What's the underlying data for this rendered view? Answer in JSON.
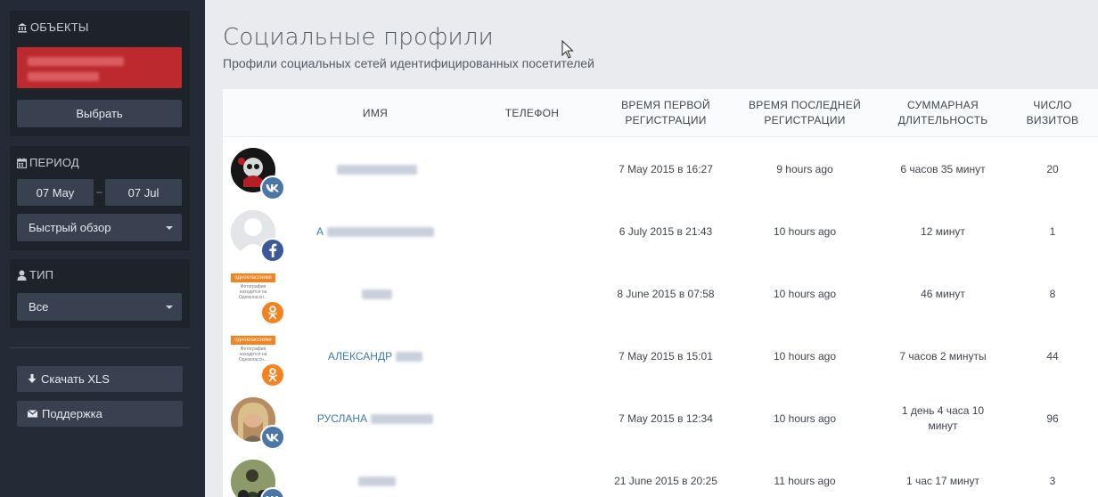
{
  "sidebar": {
    "objects": {
      "title": "ОБЪЕКТЫ",
      "select_label": "Выбрать"
    },
    "period": {
      "title": "ПЕРИОД",
      "date_from": "07 May",
      "date_to": "07 Jul",
      "dash": "–",
      "quick_view": "Быстрый обзор"
    },
    "type": {
      "title": "ТИП",
      "value": "Все"
    },
    "download_label": "Скачать XLS",
    "support_label": "Поддержка"
  },
  "main": {
    "title": "Социальные профили",
    "subtitle": "Профили социальных сетей идентифицированных посетителей",
    "columns": [
      "Имя",
      "Телефон",
      "Время первой регистрации",
      "Время последней регистрации",
      "Суммарная длительность",
      "Число визитов"
    ],
    "rows": [
      {
        "network": "vk",
        "name_visible": "",
        "first": "7 May 2015 в 16:27",
        "last": "9 hours ago",
        "duration": "6 часов 35 минут",
        "visits": "20"
      },
      {
        "network": "facebook",
        "name_visible": "А",
        "first": "6 July 2015 в 21:43",
        "last": "10 hours ago",
        "duration": "12 минут",
        "visits": "1"
      },
      {
        "network": "odnoklassniki",
        "name_visible": "",
        "first": "8 June 2015 в 07:58",
        "last": "10 hours ago",
        "duration": "46 минут",
        "visits": "8"
      },
      {
        "network": "odnoklassniki",
        "name_visible": "АЛЕКСАНДР",
        "first": "7 May 2015 в 15:01",
        "last": "10 hours ago",
        "duration": "7 часов 2 минуты",
        "visits": "44"
      },
      {
        "network": "vk",
        "name_visible": "РУСЛАНА",
        "first": "7 May 2015 в 12:34",
        "last": "10 hours ago",
        "duration": "1 день 4 часа 10 минут",
        "visits": "96"
      },
      {
        "network": "vk",
        "name_visible": "",
        "first": "21 June 2015 в 20:25",
        "last": "11 hours ago",
        "duration": "1 час 17 минут",
        "visits": "3"
      }
    ],
    "ok_thumb": {
      "brand": "одноклассники",
      "caption_line1": "Фотография",
      "caption_line2": "находится на",
      "caption_line3": "Одноклассн..."
    }
  },
  "colors": {
    "sidebar": "#252b36",
    "panel": "#1d222b",
    "object_red": "#bc2a2e",
    "vk": "#4a76a8",
    "facebook": "#3b5998",
    "odnoklassniki": "#f58220",
    "link": "#3b78b5"
  }
}
